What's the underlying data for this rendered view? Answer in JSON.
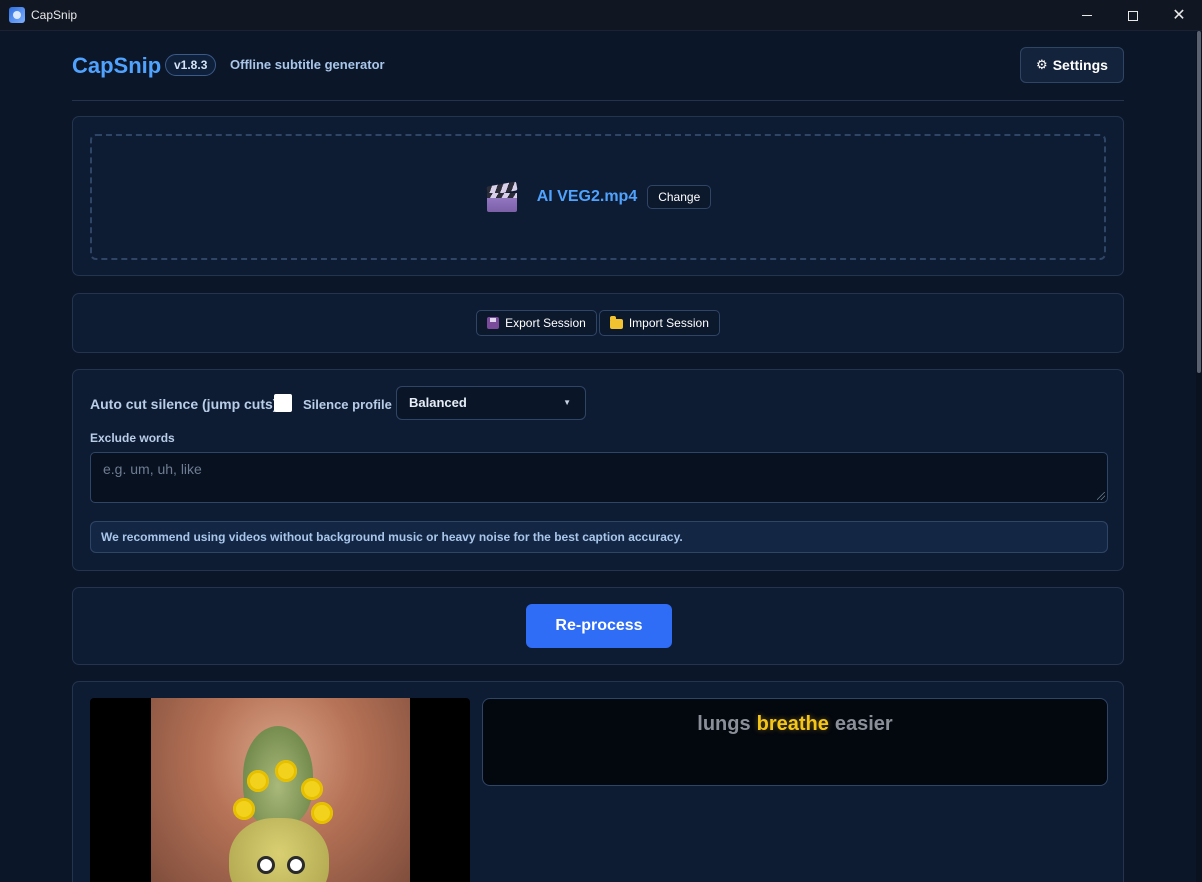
{
  "window": {
    "title": "CapSnip"
  },
  "header": {
    "brand": "CapSnip",
    "version": "v1.8.3",
    "tagline": "Offline subtitle generator",
    "settings_label": "Settings"
  },
  "file": {
    "name": "AI VEG2.mp4",
    "change_label": "Change"
  },
  "session": {
    "export_label": "Export Session",
    "import_label": "Import Session"
  },
  "options": {
    "auto_cut_label": "Auto cut silence (jump cuts)",
    "auto_cut_checked": false,
    "silence_profile_label": "Silence profile",
    "silence_profile_value": "Balanced",
    "exclude_label": "Exclude words",
    "exclude_placeholder": "e.g. um, uh, like",
    "exclude_value": "",
    "notice": "We recommend using videos without background music or heavy noise for the best caption accuracy."
  },
  "process": {
    "reprocess_label": "Re-process"
  },
  "preview": {
    "caption_words": [
      {
        "text": "lungs",
        "highlighted": false
      },
      {
        "text": "breathe",
        "highlighted": true
      },
      {
        "text": "easier",
        "highlighted": false
      }
    ]
  },
  "colors": {
    "accent": "#4fa3ff",
    "primary_button": "#2f6df6",
    "caption_highlight": "#f5c518",
    "background": "#0b1628"
  }
}
